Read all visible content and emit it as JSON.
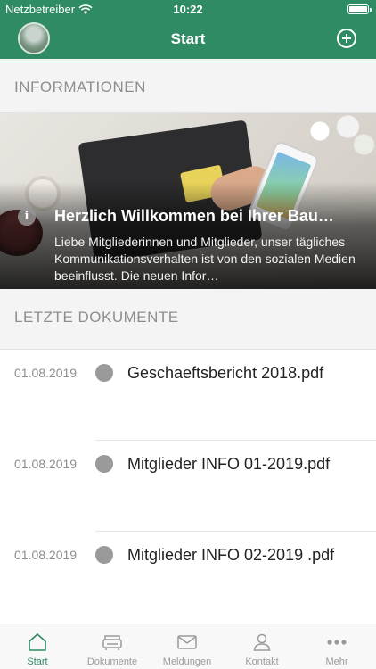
{
  "status_bar": {
    "carrier": "Netzbetreiber",
    "time": "10:22"
  },
  "nav": {
    "title": "Start"
  },
  "sections": {
    "info_header": "INFORMATIONEN",
    "docs_header": "LETZTE DOKUMENTE"
  },
  "hero": {
    "title": "Herzlich Willkommen bei Ihrer Bau…",
    "text": "Liebe Mitgliederinnen und Mitglieder, unser tägliches Kommunikationsverhalten ist von den sozialen Medien beeinflusst. Die neuen Infor…",
    "info_glyph": "i"
  },
  "documents": [
    {
      "date": "01.08.2019",
      "name": "Geschaeftsbericht 2018.pdf"
    },
    {
      "date": "01.08.2019",
      "name": "Mitglieder INFO 01-2019.pdf"
    },
    {
      "date": "01.08.2019",
      "name": "Mitglieder INFO 02-2019 .pdf"
    }
  ],
  "tabs": [
    {
      "label": "Start",
      "icon": "home-icon",
      "active": true
    },
    {
      "label": "Dokumente",
      "icon": "sofa-icon",
      "active": false
    },
    {
      "label": "Meldungen",
      "icon": "envelope-icon",
      "active": false
    },
    {
      "label": "Kontakt",
      "icon": "person-icon",
      "active": false
    },
    {
      "label": "Mehr",
      "icon": "more-dots-icon",
      "active": false
    }
  ],
  "colors": {
    "brand": "#2e8b63",
    "tab_inactive": "#9a9a9a",
    "section_bg": "#f4f4f4"
  }
}
